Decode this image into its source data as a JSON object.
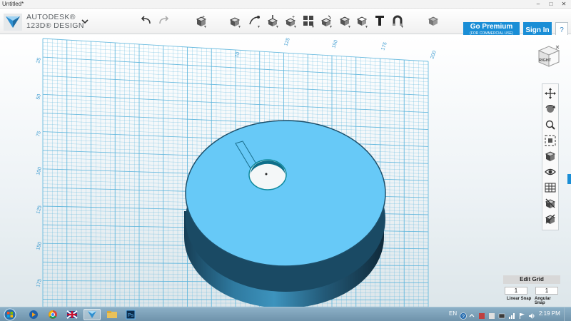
{
  "window": {
    "title": "Untitled*",
    "controls": {
      "minimize": "–",
      "maximize": "□",
      "close": "✕"
    }
  },
  "brand": {
    "line1": "AUTODESK®",
    "line2": "123D® DESIGN",
    "menu_icon": "chevron-down-icon",
    "accent": "#1a8ed6"
  },
  "toolbar": {
    "tools": [
      "undo-icon",
      "redo-icon",
      "primitives-icon",
      "sketch-icon",
      "construct-icon",
      "modify-icon",
      "pattern-icon",
      "grouping-icon",
      "snap-icon",
      "combine-icon",
      "measure-icon",
      "text-icon",
      "material-icon",
      "view-mode-icon"
    ],
    "premium_label": "Go Premium",
    "premium_sub": "(FOR COMMERCIAL USE)",
    "signin_label": "Sign In",
    "help_label": "?"
  },
  "viewcube": {
    "label": "RIGHT"
  },
  "navbar": {
    "tools": [
      "pan-icon",
      "orbit-icon",
      "zoom-icon",
      "fit-all-icon",
      "view-style-icon",
      "visibility-icon",
      "grid-settings-icon",
      "material-view-icon",
      "snap-settings-icon"
    ]
  },
  "grid": {
    "top_ruler": [
      "10",
      "125",
      "150",
      "175",
      "200"
    ],
    "left_ruler": [
      "25",
      "50",
      "75",
      "100",
      "125",
      "150",
      "175"
    ],
    "line_color": "#5ab4dc",
    "model_color": "#66c8f6"
  },
  "edit_grid": {
    "title": "Edit Grid",
    "linear_snap_value": "1",
    "linear_snap_label": "Linear Snap",
    "angular_snap_value": "1",
    "angular_snap_label": "Angular Snap"
  },
  "taskbar": {
    "apps": [
      "start-orb-icon",
      "media-player-icon",
      "chrome-icon",
      "flag-app-icon",
      "123d-design-icon",
      "explorer-icon",
      "photoshop-icon"
    ],
    "language": "EN",
    "time": "2:19 PM"
  }
}
